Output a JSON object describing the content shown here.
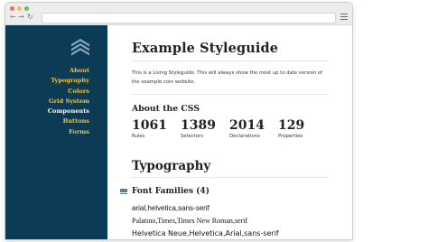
{
  "browser": {
    "nav_back": "←",
    "nav_forward": "→",
    "nav_reload": "↻",
    "menu_icon": "hamburger-menu-icon"
  },
  "sidebar": {
    "logo_icon": "chevron-stack-logo-icon",
    "items": [
      {
        "label": "About",
        "active": false
      },
      {
        "label": "Typography",
        "active": false
      },
      {
        "label": "Colors",
        "active": false
      },
      {
        "label": "Grid System",
        "active": false
      },
      {
        "label": "Components",
        "active": true
      },
      {
        "label": "Buttons",
        "active": false
      },
      {
        "label": "Forms",
        "active": false
      }
    ],
    "colors": {
      "background": "#0c3b55",
      "link": "#f5c233",
      "active": "#ffffff"
    }
  },
  "main": {
    "title": "Example Styleguide",
    "intro": "This is a Living Styleguide. This will always show the most up to date version of the example.com website.",
    "about_heading": "About the CSS",
    "stats": [
      {
        "value": "1061",
        "label": "Rules"
      },
      {
        "value": "1389",
        "label": "Selectors"
      },
      {
        "value": "2014",
        "label": "Declarations"
      },
      {
        "value": "129",
        "label": "Properties"
      }
    ],
    "typography_heading": "Typography",
    "font_families_heading": "Font Families (4)",
    "font_families": [
      "arial,helvetica,sans-serif",
      "Palatino,Times,Times New Roman,serif",
      "Helvetica Neue,Helvetica,Arial,sans-serif"
    ]
  }
}
